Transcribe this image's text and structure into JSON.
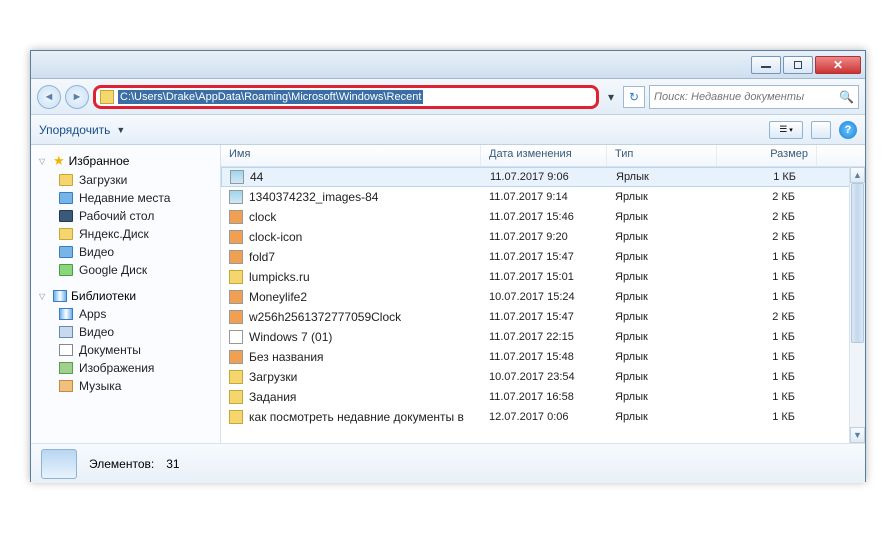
{
  "titlebar": {},
  "address": {
    "path": "C:\\Users\\Drake\\AppData\\Roaming\\Microsoft\\Windows\\Recent"
  },
  "search": {
    "placeholder": "Поиск: Недавние документы"
  },
  "toolbar": {
    "organize": "Упорядочить"
  },
  "sidebar": {
    "favorites": {
      "label": "Избранное",
      "items": [
        {
          "label": "Загрузки"
        },
        {
          "label": "Недавние места"
        },
        {
          "label": "Рабочий стол"
        },
        {
          "label": "Яндекс.Диск"
        },
        {
          "label": "Видео"
        },
        {
          "label": "Google Диск"
        }
      ]
    },
    "libraries": {
      "label": "Библиотеки",
      "items": [
        {
          "label": "Apps"
        },
        {
          "label": "Видео"
        },
        {
          "label": "Документы"
        },
        {
          "label": "Изображения"
        },
        {
          "label": "Музыка"
        }
      ]
    }
  },
  "columns": {
    "name": "Имя",
    "date": "Дата изменения",
    "type": "Тип",
    "size": "Размер"
  },
  "files": [
    {
      "name": "44",
      "date": "11.07.2017 9:06",
      "type": "Ярлык",
      "size": "1 КБ",
      "icon": "img",
      "selected": true
    },
    {
      "name": "1340374232_images-84",
      "date": "11.07.2017 9:14",
      "type": "Ярлык",
      "size": "2 КБ",
      "icon": "img"
    },
    {
      "name": "clock",
      "date": "11.07.2017 15:46",
      "type": "Ярлык",
      "size": "2 КБ",
      "icon": "clk"
    },
    {
      "name": "clock-icon",
      "date": "11.07.2017 9:20",
      "type": "Ярлык",
      "size": "2 КБ",
      "icon": "clk"
    },
    {
      "name": "fold7",
      "date": "11.07.2017 15:47",
      "type": "Ярлык",
      "size": "1 КБ",
      "icon": "clk"
    },
    {
      "name": "lumpicks.ru",
      "date": "11.07.2017 15:01",
      "type": "Ярлык",
      "size": "1 КБ",
      "icon": "fold"
    },
    {
      "name": "Moneylife2",
      "date": "10.07.2017 15:24",
      "type": "Ярлык",
      "size": "1 КБ",
      "icon": "clk"
    },
    {
      "name": "w256h2561372777059Clock",
      "date": "11.07.2017 15:47",
      "type": "Ярлык",
      "size": "2 КБ",
      "icon": "clk"
    },
    {
      "name": "Windows 7 (01)",
      "date": "11.07.2017 22:15",
      "type": "Ярлык",
      "size": "1 КБ",
      "icon": "doc"
    },
    {
      "name": "Без названия",
      "date": "11.07.2017 15:48",
      "type": "Ярлык",
      "size": "1 КБ",
      "icon": "clk"
    },
    {
      "name": "Загрузки",
      "date": "10.07.2017 23:54",
      "type": "Ярлык",
      "size": "1 КБ",
      "icon": "fold"
    },
    {
      "name": "Задания",
      "date": "11.07.2017 16:58",
      "type": "Ярлык",
      "size": "1 КБ",
      "icon": "fold"
    },
    {
      "name": "как посмотреть недавние документы в",
      "date": "12.07.2017 0:06",
      "type": "Ярлык",
      "size": "1 КБ",
      "icon": "fold"
    }
  ],
  "status": {
    "label": "Элементов:",
    "count": "31"
  }
}
